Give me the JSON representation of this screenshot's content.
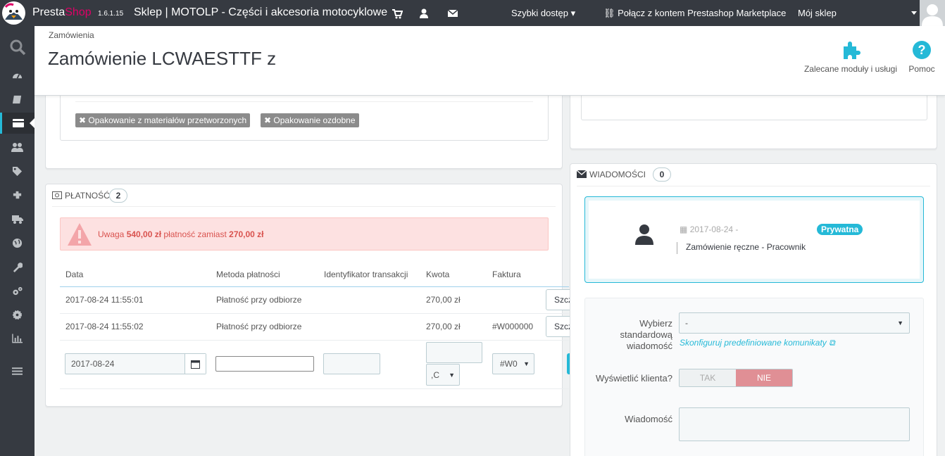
{
  "topbar": {
    "brand_presta": "Presta",
    "brand_shop": "Shop",
    "version": "1.6.1.15",
    "shop_name": "Sklep | MOTOLP - Części i akcesoria motocyklowe",
    "quick_access": "Szybki dostęp",
    "marketplace": "Połącz z kontem Prestashop Marketplace",
    "my_shop": "Mój sklep"
  },
  "header": {
    "breadcrumb": "Zamówienia",
    "title": "Zamówienie LCWAESTTF z",
    "recommended": "Zalecane moduły i usługi",
    "help": "Pomoc"
  },
  "left_panel": {
    "tags": [
      "Opakowanie z materiałów przetworzonych",
      "Opakowanie ozdobne"
    ]
  },
  "payment": {
    "heading": "Płatność",
    "count": "2",
    "alert_prefix": "Uwaga",
    "alert_amount1": "540,00 zł",
    "alert_mid": "płatność zamiast",
    "alert_amount2": "270,00 zł",
    "columns": [
      "Data",
      "Metoda płatności",
      "Identyfikator transakcji",
      "Kwota",
      "Faktura"
    ],
    "rows": [
      {
        "date": "2017-08-24 11:55:01",
        "method": "Płatność przy odbiorze",
        "transaction": "",
        "amount": "270,00 zł",
        "invoice": "",
        "btn": "Szczegóły"
      },
      {
        "date": "2017-08-24 11:55:02",
        "method": "Płatność przy odbiorze",
        "transaction": "",
        "amount": "270,00 zł",
        "invoice": "#W000000",
        "btn": "Szczegóły"
      }
    ],
    "form": {
      "date_value": "2017-08-24",
      "currency_value": ",C",
      "invoice_value": "#W0"
    }
  },
  "messages": {
    "heading": "Wiadomości",
    "count": "0",
    "msg_date": "2017-08-24 -",
    "msg_badge": "Prywatna",
    "msg_text": "Zamówienie ręczne - Pracownik",
    "label_choose": "Wybierz standardową wiadomość",
    "choose_value": "-",
    "configure_link": "Skonfiguruj predefiniowane komunikaty",
    "label_show": "Wyświetlić klienta?",
    "switch_yes": "TAK",
    "switch_no": "NIE",
    "label_message": "Wiadomość"
  },
  "colors": {
    "topbar": "#363a41",
    "accent": "#25b9d7",
    "danger_bg": "#fde1e1",
    "danger_text": "#d9534f",
    "switch_off": "#e08f95"
  }
}
